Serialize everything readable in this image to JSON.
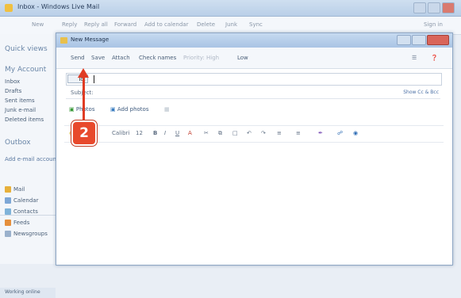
{
  "outer_window": {
    "title": "Inbox - Windows Live Mail",
    "toolbar": [
      "New",
      "Reply",
      "Reply all",
      "Forward",
      "Add to calendar",
      "Delete",
      "Junk",
      "Sync",
      "Sign in"
    ]
  },
  "left_pane": {
    "quick_views": "Quick views",
    "account": "My Account",
    "folders": [
      "Inbox",
      "Drafts",
      "Sent items",
      "Junk e-mail",
      "Deleted items"
    ],
    "outbox": "Outbox",
    "add_email": "Add e-mail account",
    "nav": [
      "Mail",
      "Calendar",
      "Contacts",
      "Feeds",
      "Newsgroups"
    ],
    "footer": "Working online"
  },
  "message_window": {
    "title": "New Message",
    "toolbar": [
      "Send",
      "Save",
      "Attach",
      "Check names",
      "Priority: High",
      "Low"
    ],
    "to_label": "To:",
    "to_value": "",
    "subject_label": "Subject:",
    "show_cc": "Show Cc & Bcc",
    "attach_items": [
      "Photos",
      "Add photos"
    ],
    "format": {
      "style": "Calibri",
      "size": "12"
    }
  },
  "callout": {
    "number": "2",
    "color": "#e8492c"
  }
}
